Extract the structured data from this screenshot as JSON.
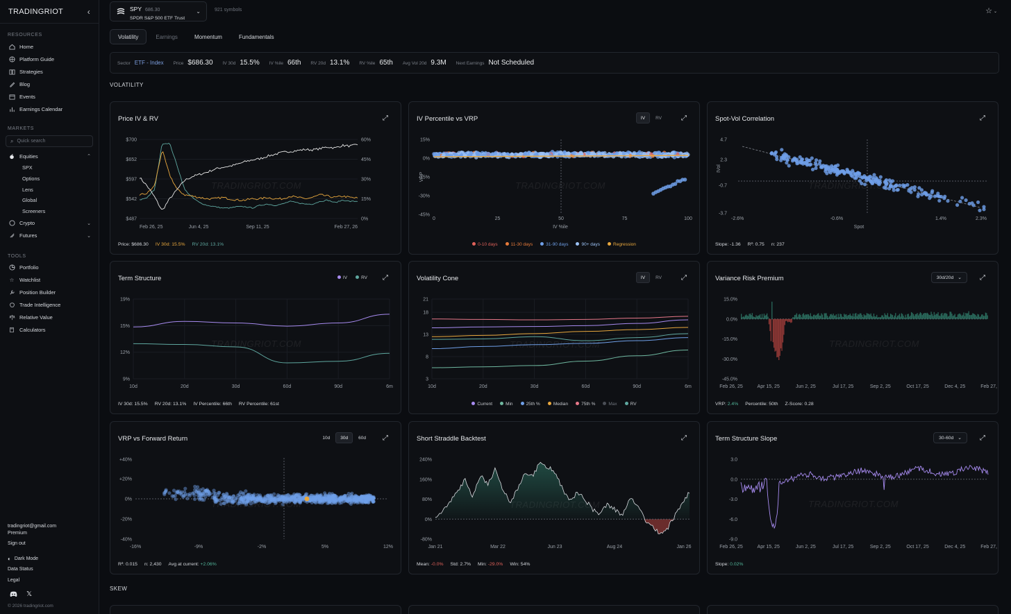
{
  "sidebar": {
    "brand": "TRADINGRIOT",
    "resources_title": "RESOURCES",
    "resources": [
      {
        "label": "Home",
        "icon": "home-icon"
      },
      {
        "label": "Platform Guide",
        "icon": "globe-icon"
      },
      {
        "label": "Strategies",
        "icon": "book-icon"
      },
      {
        "label": "Blog",
        "icon": "pen-icon"
      },
      {
        "label": "Events",
        "icon": "calendar-icon"
      },
      {
        "label": "Earnings Calendar",
        "icon": "bars-icon"
      }
    ],
    "markets_title": "MARKETS",
    "search_placeholder": "Quick search",
    "equities": "Equities",
    "equities_sub": [
      "SPX",
      "Options",
      "Lens",
      "Global",
      "Screeners"
    ],
    "crypto": "Crypto",
    "futures": "Futures",
    "tools_title": "TOOLS",
    "tools": [
      {
        "label": "Portfolio",
        "icon": "pie-icon"
      },
      {
        "label": "Watchlist",
        "icon": "star-icon"
      },
      {
        "label": "Position Builder",
        "icon": "wrench-icon"
      },
      {
        "label": "Trade Intelligence",
        "icon": "brain-icon"
      },
      {
        "label": "Relative Value",
        "icon": "scale-icon"
      },
      {
        "label": "Calculators",
        "icon": "calculator-icon"
      }
    ],
    "email": "tradingriot@gmail.com",
    "tier": "Premium",
    "sign_out": "Sign out",
    "dark_mode": "Dark Mode",
    "data_status": "Data Status",
    "legal": "Legal",
    "copyright": "© 2026 tradingriot.com"
  },
  "header": {
    "symbol": "SPY",
    "price": "686.30",
    "name": "SPDR S&P 500 ETF Trust",
    "symbol_count": "921 symbols"
  },
  "tabs": [
    "Volatility",
    "Earnings",
    "Momentum",
    "Fundamentals"
  ],
  "stats": {
    "sector_label": "Sector",
    "sector_value": "ETF - Index",
    "price_label": "Price",
    "price_value": "$686.30",
    "iv30_label": "IV 30d",
    "iv30_value": "15.5%",
    "ivpct_label": "IV %ile",
    "ivpct_value": "66th",
    "rv20_label": "RV 20d",
    "rv20_value": "13.1%",
    "rvpct_label": "RV %ile",
    "rvpct_value": "65th",
    "avgvol_label": "Avg Vol 20d",
    "avgvol_value": "9.3M",
    "earn_label": "Next Earnings",
    "earn_value": "Not Scheduled"
  },
  "sections": {
    "volatility": "VOLATILITY",
    "skew": "SKEW"
  },
  "watermark": "TRADINGRIOT.COM",
  "colors": {
    "iv": "#e9a83e",
    "rv": "#5fa8a0",
    "price": "#e8e8e8",
    "accent": "#7d9fe0",
    "purple": "#a78bf0",
    "blue": "#6f9fe8",
    "positive": "#52b59a",
    "negative": "#e0615a"
  },
  "cards": {
    "price_iv_rv": {
      "title": "Price IV & RV",
      "foot_price": "Price: $686.30",
      "foot_iv": "IV 30d: 15.5%",
      "foot_rv": "RV 20d: 13.1%"
    },
    "iv_pct_vrp": {
      "title": "IV Percentile vs VRP",
      "toggle": [
        "IV",
        "RV"
      ],
      "xlabel": "IV %ile",
      "ylabel": "VRP",
      "legend": [
        "0-10 days",
        "11-30 days",
        "31-90 days",
        "90+ days",
        "Regression"
      ]
    },
    "spot_vol": {
      "title": "Spot-Vol Correlation",
      "xlabel": "Spot",
      "ylabel": "IVol",
      "foot_slope": "Slope: -1.36",
      "foot_r2": "R²: 0.75",
      "foot_n": "n: 237"
    },
    "term_structure": {
      "title": "Term Structure",
      "legend": [
        "IV",
        "RV"
      ],
      "foot": [
        "IV 30d: 15.5%",
        "RV 20d: 13.1%",
        "IV Percentile: 66th",
        "RV Percentile: 61st"
      ]
    },
    "vol_cone": {
      "title": "Volatility Cone",
      "toggle": [
        "IV",
        "RV"
      ],
      "legend": [
        "Current",
        "Min",
        "25th %",
        "Median",
        "75th %",
        "Max",
        "RV"
      ]
    },
    "vrp": {
      "title": "Variance Risk Premium",
      "dropdown": "30d/20d",
      "foot_label": "VRP:",
      "foot_vrp": "2.4%",
      "foot_pct": "Percentile: 50th",
      "foot_z": "Z-Score: 0.28"
    },
    "vrp_fwd": {
      "title": "VRP vs Forward Return",
      "toggle": [
        "10d",
        "30d",
        "60d"
      ],
      "foot_r2": "R²: 0.015",
      "foot_n": "n: 2,430",
      "foot_avg_label": "Avg at current:",
      "foot_avg": "+2.06%"
    },
    "straddle": {
      "title": "Short Straddle Backtest",
      "foot_mean_label": "Mean:",
      "foot_mean": "-0.0%",
      "foot_std": "Std: 2.7%",
      "foot_min_label": "Min:",
      "foot_min": "-29.0%",
      "foot_win": "Win: 54%"
    },
    "ts_slope": {
      "title": "Term Structure Slope",
      "dropdown": "30-60d",
      "foot_label": "Slope:",
      "foot_slope": "0.02%"
    }
  },
  "chart_data": [
    {
      "type": "line",
      "title": "Price IV & RV",
      "x_ticks": [
        "Feb 26, 25",
        "Jun 4, 25",
        "Sep 11, 25",
        "Feb 27, 26"
      ],
      "y_left_ticks": [
        "$700",
        "$652",
        "$597",
        "$542",
        "$487"
      ],
      "y_right_ticks": [
        "60%",
        "45%",
        "30%",
        "15%",
        "0%"
      ],
      "series": [
        {
          "name": "Price",
          "values": [
            598,
            575,
            545,
            508,
            540,
            565,
            590,
            600,
            606,
            612,
            620,
            625,
            628,
            633,
            640,
            645,
            648,
            655,
            660,
            665,
            668,
            670,
            673,
            672,
            675,
            680,
            677,
            684,
            682,
            686
          ]
        },
        {
          "name": "IV 30d",
          "values": [
            18,
            19,
            25,
            52,
            33,
            22,
            18,
            17,
            16,
            15,
            15,
            16,
            15,
            14,
            14,
            15,
            15,
            16,
            15,
            15,
            17,
            16,
            15,
            16,
            18,
            17,
            16,
            17,
            16,
            15.5
          ]
        },
        {
          "name": "RV 20d",
          "values": [
            14,
            16,
            22,
            57,
            57,
            40,
            22,
            16,
            12,
            10,
            9,
            8,
            8,
            9,
            9,
            8,
            10,
            11,
            10,
            11,
            13,
            12,
            11,
            11,
            13,
            14,
            12,
            14,
            13,
            13.1
          ]
        }
      ]
    },
    {
      "type": "scatter",
      "title": "IV Percentile vs VRP",
      "x_ticks": [
        "0",
        "25",
        "50",
        "75",
        "100"
      ],
      "y_ticks": [
        "15%",
        "0%",
        "-15%",
        "-30%",
        "-45%"
      ],
      "xlabel": "IV %ile",
      "ylabel": "VRP"
    },
    {
      "type": "scatter",
      "title": "Spot-Vol Correlation",
      "x_ticks": [
        "-2.6%",
        "-0.6%",
        "1.4%",
        "2.3%"
      ],
      "y_ticks": [
        "4.7",
        "2.3",
        "-0.7",
        "-3.7"
      ],
      "xlabel": "Spot",
      "ylabel": "IVol"
    },
    {
      "type": "line",
      "title": "Term Structure",
      "x_ticks": [
        "10d",
        "20d",
        "30d",
        "60d",
        "90d",
        "6m"
      ],
      "y_ticks": [
        "19%",
        "15%",
        "12%",
        "9%"
      ],
      "series": [
        {
          "name": "IV",
          "values": [
            15.5,
            16.2,
            16.0,
            15.6,
            16.0,
            17.1
          ]
        },
        {
          "name": "RV",
          "values": [
            13.4,
            13.3,
            13.0,
            11.0,
            11.2,
            12.2
          ]
        }
      ]
    },
    {
      "type": "line",
      "title": "Volatility Cone",
      "x_ticks": [
        "10d",
        "20d",
        "30d",
        "60d",
        "90d",
        "6m"
      ],
      "y_ticks": [
        "21",
        "18",
        "13",
        "8",
        "3"
      ],
      "series": [
        {
          "name": "Current",
          "values": [
            14.5,
            14.7,
            14.8,
            15,
            15.5,
            16.3
          ]
        },
        {
          "name": "Min",
          "values": [
            5.5,
            5.7,
            6,
            7,
            8.2,
            9.5
          ]
        },
        {
          "name": "25th %",
          "values": [
            9.8,
            10.3,
            10.7,
            11,
            11.6,
            12.3
          ]
        },
        {
          "name": "Median",
          "values": [
            12.5,
            12.8,
            13.2,
            13.7,
            14.1,
            14.6
          ]
        },
        {
          "name": "75th %",
          "values": [
            16.5,
            16.4,
            16.3,
            16.4,
            16.7,
            17.1
          ]
        },
        {
          "name": "Max",
          "values": [
            22.7,
            22.6,
            22.5,
            22.3,
            22.1,
            21.9
          ]
        },
        {
          "name": "RV",
          "values": [
            11.9,
            12,
            12.5,
            11.6,
            12.3,
            13.2
          ]
        }
      ]
    },
    {
      "type": "bar",
      "title": "Variance Risk Premium",
      "x_ticks": [
        "Feb 26, 25",
        "Apr 15, 25",
        "Jun 2, 25",
        "Jul 17, 25",
        "Sep 2, 25",
        "Oct 17, 25",
        "Dec 4, 25",
        "Feb 27, 26"
      ],
      "y_ticks": [
        "15.0%",
        "0.0%",
        "-15.0%",
        "-30.0%",
        "-45.0%"
      ]
    },
    {
      "type": "scatter",
      "title": "VRP vs Forward Return",
      "x_ticks": [
        "-16%",
        "-9%",
        "-2%",
        "5%",
        "12%"
      ],
      "y_ticks": [
        "+40%",
        "+20%",
        "0%",
        "-20%",
        "-40%"
      ]
    },
    {
      "type": "area",
      "title": "Short Straddle Backtest",
      "x_ticks": [
        "Jan 21",
        "Mar 22",
        "Jun 23",
        "Aug 24",
        "Jan 26"
      ],
      "y_ticks": [
        "240%",
        "160%",
        "80%",
        "0%",
        "-80%"
      ],
      "values": [
        0,
        40,
        70,
        110,
        160,
        90,
        180,
        140,
        200,
        120,
        70,
        120,
        190,
        170,
        230,
        210,
        190,
        120,
        70,
        110,
        80,
        40,
        20,
        60,
        40,
        10,
        90,
        60,
        0,
        -30,
        -60,
        -40,
        10,
        60,
        110
      ]
    },
    {
      "type": "line",
      "title": "Term Structure Slope",
      "x_ticks": [
        "Feb 26, 25",
        "Apr 15, 25",
        "Jun 2, 25",
        "Jul 17, 25",
        "Sep 2, 25",
        "Oct 17, 25",
        "Dec 4, 25",
        "Feb 27, 26"
      ],
      "y_ticks": [
        "3.0",
        "0.0",
        "-3.0",
        "-6.0",
        "-9.0"
      ]
    }
  ]
}
